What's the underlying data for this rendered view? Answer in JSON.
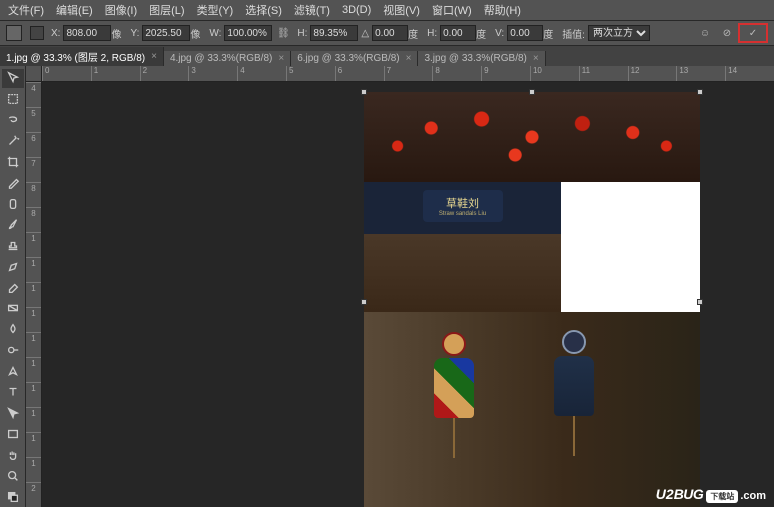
{
  "menu": [
    "文件(F)",
    "编辑(E)",
    "图像(I)",
    "图层(L)",
    "类型(Y)",
    "选择(S)",
    "滤镜(T)",
    "3D(D)",
    "视图(V)",
    "窗口(W)",
    "帮助(H)"
  ],
  "options": {
    "x_label": "X:",
    "x_value": "808.00",
    "x_unit": "像",
    "y_label": "Y:",
    "y_value": "2025.50",
    "y_unit": "像",
    "w_label": "W:",
    "w_value": "100.00%",
    "h_label": "H:",
    "h_value": "89.35%",
    "angle_label": "△",
    "angle_value": "0.00",
    "angle_unit": "度",
    "hskew_label": "H:",
    "hskew_value": "0.00",
    "hskew_unit": "度",
    "vskew_label": "V:",
    "vskew_value": "0.00",
    "vskew_unit": "度",
    "interp_label": "插值:",
    "interp_value": "两次立方"
  },
  "tabs": [
    {
      "label": "1.jpg @ 33.3% (图层 2, RGB/8)",
      "active": true
    },
    {
      "label": "4.jpg @ 33.3%(RGB/8)",
      "active": false
    },
    {
      "label": "6.jpg @ 33.3%(RGB/8)",
      "active": false
    },
    {
      "label": "3.jpg @ 33.3%(RGB/8)",
      "active": false
    }
  ],
  "ruler_h": [
    "0",
    "1",
    "2",
    "3",
    "4",
    "5",
    "6",
    "7",
    "8",
    "9",
    "10",
    "11",
    "12",
    "13",
    "14"
  ],
  "ruler_v": [
    "4",
    "5",
    "6",
    "7",
    "8",
    "8",
    "1",
    "1",
    "1",
    "1",
    "1",
    "1",
    "1",
    "1",
    "1",
    "1",
    "2"
  ],
  "sign": {
    "main": "草鞋刘",
    "sub": "Straw sandals Liu"
  },
  "watermark": {
    "prefix": "U2",
    "mid": "BUG",
    "bubble": "下载站",
    "suffix": ".com"
  },
  "tool_names": [
    "move",
    "marquee",
    "lasso",
    "wand",
    "crop",
    "eyedropper",
    "heal",
    "brush",
    "stamp",
    "history",
    "eraser",
    "gradient",
    "blur",
    "dodge",
    "pen",
    "type",
    "path",
    "rect",
    "hand",
    "zoom",
    "fg-bg"
  ]
}
